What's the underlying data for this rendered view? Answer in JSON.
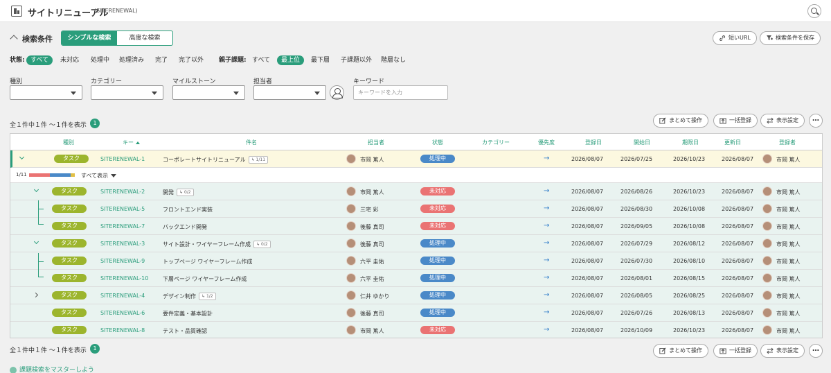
{
  "header": {
    "title": "サイトリニューアル",
    "project_key": "(SITERENEWAL)"
  },
  "search_conditions": {
    "title": "検索条件",
    "modes": [
      "シンプルな検索",
      "高度な検索"
    ],
    "short_url": "短いURL",
    "save_conditions": "検索条件を保存",
    "status_label": "状態:",
    "status_chips": [
      "すべて",
      "未対応",
      "処理中",
      "処理済み",
      "完了",
      "完了以外"
    ],
    "parent_label": "親子課題:",
    "parent_chips": [
      "すべて",
      "最上位",
      "最下層",
      "子課題以外",
      "階層なし"
    ],
    "fields": {
      "type": "種別",
      "category": "カテゴリー",
      "milestone": "マイルストーン",
      "assignee": "担当者",
      "keyword": "キーワード"
    },
    "keyword_placeholder": "キーワードを入力"
  },
  "result": {
    "count_text": "全１件中１件 〜１件を表示",
    "badge": "1",
    "bulk_action": "まとめて操作",
    "bulk_register": "一括登録",
    "display_settings": "表示設定",
    "more": "…"
  },
  "table": {
    "headers": [
      "種別",
      "キー",
      "件名",
      "担当者",
      "状態",
      "カテゴリー",
      "優先度",
      "登録日",
      "開始日",
      "期限日",
      "更新日",
      "登録者"
    ],
    "progress_label": "1/11",
    "progress_segments": [
      {
        "color": "#ea7373",
        "fraction": 0.46
      },
      {
        "color": "#4a89c8",
        "fraction": 0.45
      },
      {
        "color": "#e2c046",
        "fraction": 0.09
      }
    ],
    "show_all": "すべて表示",
    "priority_arrow": "→",
    "rows": [
      {
        "type": "タスク",
        "key": "SITERENEWAL-1",
        "title": "コーポレートサイトリニューアル",
        "child_count": "1/11",
        "assignee": "市岡 篤人",
        "status": "処理中",
        "status_kind": "prog",
        "created": "2026/08/07",
        "start": "2026/07/25",
        "due": "2026/10/23",
        "updated": "2026/08/07",
        "registrant": "市岡 篤人"
      },
      {
        "type": "タスク",
        "key": "SITERENEWAL-2",
        "title": "開発",
        "child_count": "0/2",
        "assignee": "市岡 篤人",
        "status": "未対応",
        "status_kind": "open",
        "created": "2026/08/07",
        "start": "2026/08/26",
        "due": "2026/10/23",
        "updated": "2026/08/07",
        "registrant": "市岡 篤人"
      },
      {
        "type": "タスク",
        "key": "SITERENEWAL-5",
        "title": "フロントエンド実装",
        "child_count": "",
        "assignee": "三宅 彩",
        "status": "未対応",
        "status_kind": "open",
        "created": "2026/08/07",
        "start": "2026/08/30",
        "due": "2026/10/08",
        "updated": "2026/08/07",
        "registrant": "市岡 篤人"
      },
      {
        "type": "タスク",
        "key": "SITERENEWAL-7",
        "title": "バックエンド開発",
        "child_count": "",
        "assignee": "後藤 真司",
        "status": "未対応",
        "status_kind": "open",
        "created": "2026/08/07",
        "start": "2026/09/05",
        "due": "2026/10/08",
        "updated": "2026/08/07",
        "registrant": "市岡 篤人"
      },
      {
        "type": "タスク",
        "key": "SITERENEWAL-3",
        "title": "サイト設計・ワイヤーフレーム作成",
        "child_count": "0/2",
        "assignee": "後藤 真司",
        "status": "処理中",
        "status_kind": "prog",
        "created": "2026/08/07",
        "start": "2026/07/29",
        "due": "2026/08/12",
        "updated": "2026/08/07",
        "registrant": "市岡 篤人"
      },
      {
        "type": "タスク",
        "key": "SITERENEWAL-9",
        "title": "トップページ ワイヤーフレーム作成",
        "child_count": "",
        "assignee": "六平 圭佑",
        "status": "処理中",
        "status_kind": "prog",
        "created": "2026/08/07",
        "start": "2026/07/30",
        "due": "2026/08/10",
        "updated": "2026/08/07",
        "registrant": "市岡 篤人"
      },
      {
        "type": "タスク",
        "key": "SITERENEWAL-10",
        "title": "下層ページ ワイヤーフレーム作成",
        "child_count": "",
        "assignee": "六平 圭佑",
        "status": "処理中",
        "status_kind": "prog",
        "created": "2026/08/07",
        "start": "2026/08/01",
        "due": "2026/08/15",
        "updated": "2026/08/07",
        "registrant": "市岡 篤人"
      },
      {
        "type": "タスク",
        "key": "SITERENEWAL-4",
        "title": "デザイン制作",
        "child_count": "1/2",
        "assignee": "仁井 ゆかり",
        "status": "処理中",
        "status_kind": "prog",
        "created": "2026/08/07",
        "start": "2026/08/05",
        "due": "2026/08/25",
        "updated": "2026/08/07",
        "registrant": "市岡 篤人"
      },
      {
        "type": "タスク",
        "key": "SITERENEWAL-6",
        "title": "要件定義・基本設計",
        "child_count": "",
        "assignee": "後藤 真司",
        "status": "処理中",
        "status_kind": "prog",
        "created": "2026/08/07",
        "start": "2026/07/26",
        "due": "2026/08/13",
        "updated": "2026/08/07",
        "registrant": "市岡 篤人"
      },
      {
        "type": "タスク",
        "key": "SITERENEWAL-8",
        "title": "テスト・品質確認",
        "child_count": "",
        "assignee": "市岡 篤人",
        "status": "未対応",
        "status_kind": "open",
        "created": "2026/08/07",
        "start": "2026/10/09",
        "due": "2026/10/23",
        "updated": "2026/08/07",
        "registrant": "市岡 篤人"
      }
    ]
  },
  "footer": {
    "help_link": "課題検索をマスターしよう"
  }
}
